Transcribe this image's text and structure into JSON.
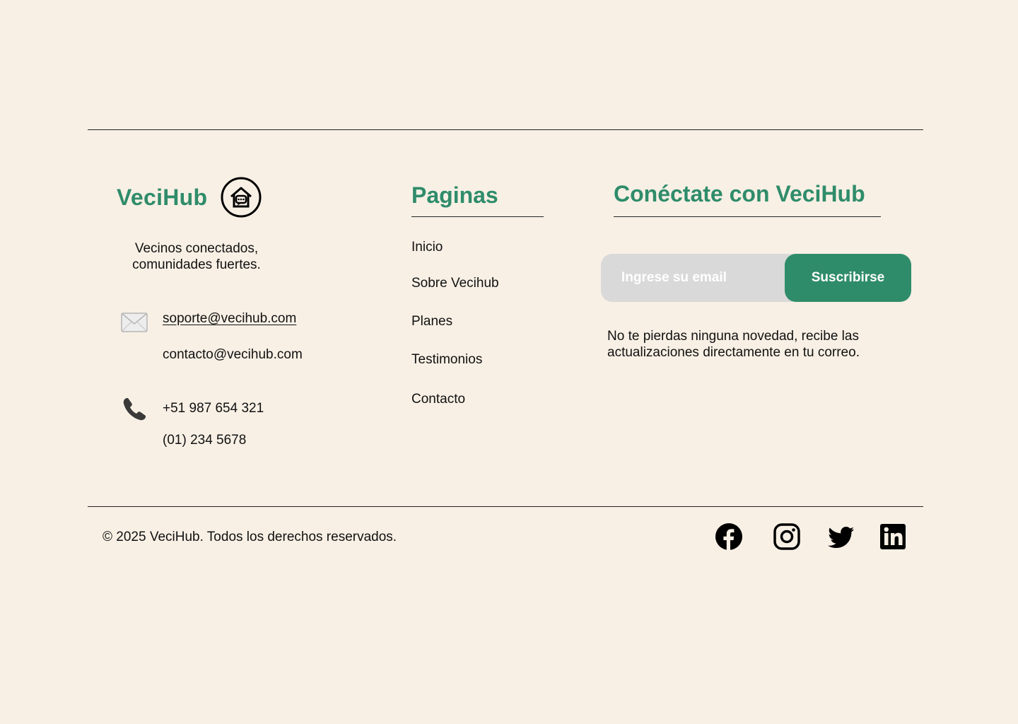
{
  "brand": {
    "name": "VeciHub",
    "logo_icon": "house-chat-icon",
    "tagline": "Vecinos conectados, comunidades fuertes."
  },
  "contact": {
    "email_icon": "envelope-icon",
    "emails": [
      "soporte@vecihub.com",
      "contacto@vecihub.com"
    ],
    "phone_icon": "phone-icon",
    "phones": [
      "+51 987 654 321",
      "(01) 234 5678"
    ]
  },
  "pages": {
    "title": "Paginas",
    "links": [
      "Inicio",
      "Sobre Vecihub",
      "Planes",
      "Testimonios",
      "Contacto"
    ]
  },
  "connect": {
    "title": "Conéctate con VeciHub",
    "email_placeholder": "Ingrese su email",
    "email_value": "",
    "subscribe_label": "Suscribirse",
    "description": "No te pierdas ninguna novedad, recibe las actualizaciones directamente en tu correo."
  },
  "footer": {
    "copyright": "© 2025 VeciHub. Todos los derechos reservados.",
    "social": [
      "facebook-icon",
      "instagram-icon",
      "twitter-icon",
      "linkedin-icon"
    ]
  },
  "colors": {
    "background": "#F8F0E5",
    "accent": "#2F8C6A",
    "input": "#D9D9D9",
    "text": "#111111"
  }
}
